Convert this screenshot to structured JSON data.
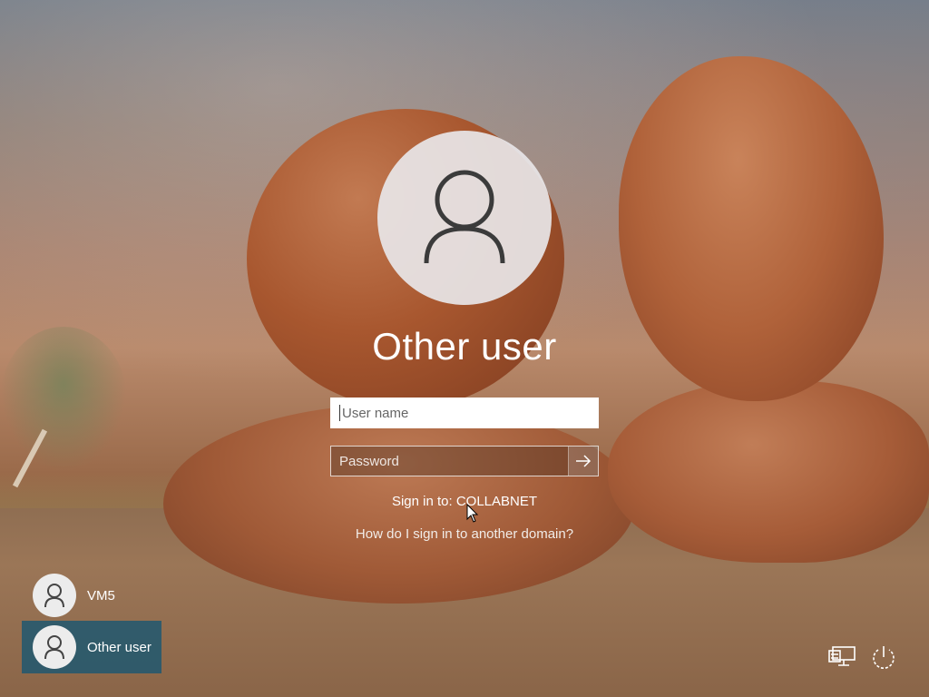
{
  "login": {
    "title": "Other user",
    "username_placeholder": "User name",
    "password_placeholder": "Password",
    "sign_in_to": "Sign in to: COLLABNET",
    "domain_help": "How do I sign in to another domain?"
  },
  "users": [
    {
      "name": "VM5",
      "selected": false
    },
    {
      "name": "Other user",
      "selected": true
    }
  ],
  "icons": {
    "avatar": "person-icon",
    "submit": "arrow-right-icon",
    "network": "network-icon",
    "power": "power-icon"
  },
  "colors": {
    "selected_tile": "#205870",
    "input_bg": "#ffffff"
  }
}
